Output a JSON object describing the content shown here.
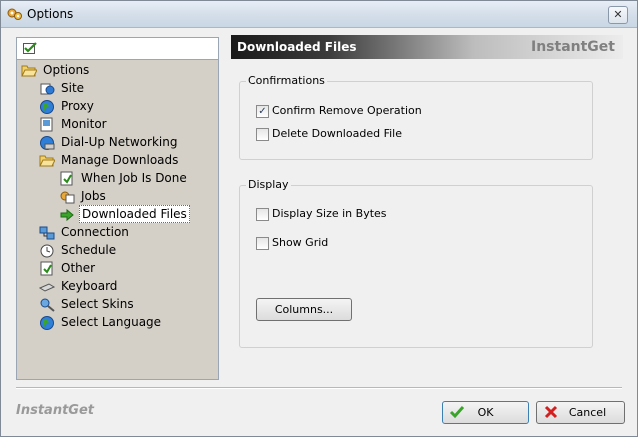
{
  "window": {
    "title": "Options",
    "close_glyph": "✕"
  },
  "tree": {
    "items": [
      {
        "label": "Options",
        "icon": "folder-open-icon"
      },
      {
        "label": "Site",
        "icon": "site-icon"
      },
      {
        "label": "Proxy",
        "icon": "globe-icon"
      },
      {
        "label": "Monitor",
        "icon": "monitor-icon"
      },
      {
        "label": "Dial-Up Networking",
        "icon": "dialup-icon"
      },
      {
        "label": "Manage Downloads",
        "icon": "folder-open-icon"
      },
      {
        "label": "When Job Is Done",
        "icon": "document-icon"
      },
      {
        "label": "Jobs",
        "icon": "jobs-icon"
      },
      {
        "label": "Downloaded Files",
        "icon": "arrow-icon"
      },
      {
        "label": "Connection",
        "icon": "connection-icon"
      },
      {
        "label": "Schedule",
        "icon": "clock-icon"
      },
      {
        "label": "Other",
        "icon": "document-icon"
      },
      {
        "label": "Keyboard",
        "icon": "keyboard-icon"
      },
      {
        "label": "Select Skins",
        "icon": "skins-icon"
      },
      {
        "label": "Select Language",
        "icon": "globe-icon"
      }
    ]
  },
  "header": {
    "title": "Downloaded Files",
    "brand": "InstantGet"
  },
  "confirmations": {
    "label": "Confirmations",
    "confirm_remove": {
      "label": "Confirm Remove Operation",
      "checked": true,
      "mark": "✓"
    },
    "delete_files": {
      "label": "Delete Downloaded File",
      "checked": false
    }
  },
  "display": {
    "label": "Display",
    "size_bytes": {
      "label": "Display Size in Bytes",
      "checked": false
    },
    "show_grid": {
      "label": "Show Grid",
      "checked": false
    },
    "columns_button": "Columns..."
  },
  "footer": {
    "brand": "InstantGet",
    "ok": "OK",
    "cancel": "Cancel"
  },
  "colors": {
    "accent_green": "#3aa52a",
    "cancel_red": "#d21f1f",
    "folder_yellow": "#e8c24a"
  }
}
